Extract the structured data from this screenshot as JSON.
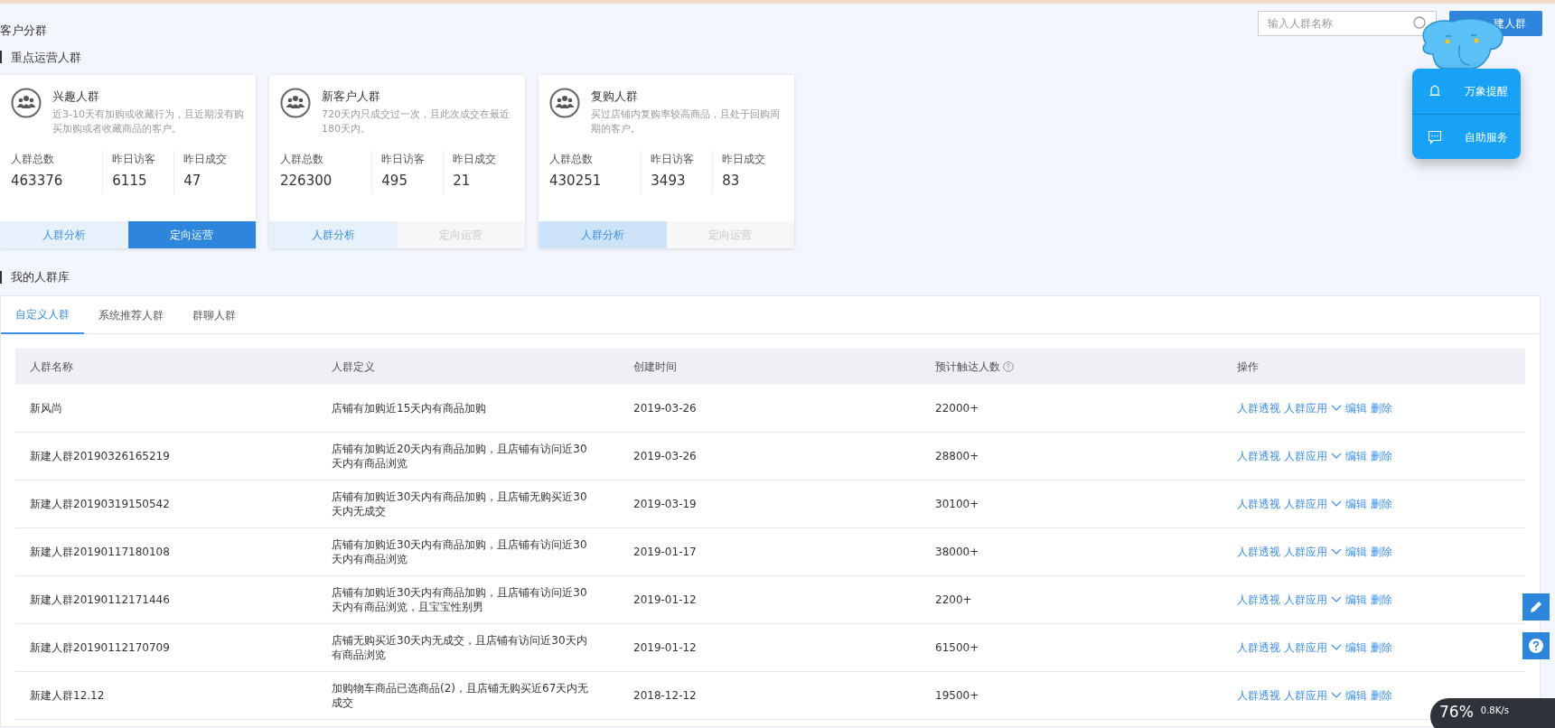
{
  "page_title": "客户分群",
  "search": {
    "placeholder": "输入人群名称"
  },
  "create_button": "建人群",
  "featured": {
    "title": "重点运营人群",
    "cards": [
      {
        "name": "兴趣人群",
        "desc": "近3-10天有加购或收藏行为，且近期没有购买加购或者收藏商品的客户。",
        "stats": [
          {
            "label": "人群总数",
            "value": "463376"
          },
          {
            "label": "昨日访客",
            "value": "6115"
          },
          {
            "label": "昨日成交",
            "value": "47"
          }
        ],
        "analysis": {
          "label": "人群分析",
          "highlighted": false
        },
        "operate": {
          "label": "定向运营",
          "disabled": false
        }
      },
      {
        "name": "新客户人群",
        "desc": "720天内只成交过一次，且此次成交在最近180天内。",
        "stats": [
          {
            "label": "人群总数",
            "value": "226300"
          },
          {
            "label": "昨日访客",
            "value": "495"
          },
          {
            "label": "昨日成交",
            "value": "21"
          }
        ],
        "analysis": {
          "label": "人群分析",
          "highlighted": false
        },
        "operate": {
          "label": "定向运营",
          "disabled": true
        }
      },
      {
        "name": "复购人群",
        "desc": "买过店铺内复购率较高商品，且处于回购周期的客户。",
        "stats": [
          {
            "label": "人群总数",
            "value": "430251"
          },
          {
            "label": "昨日访客",
            "value": "3493"
          },
          {
            "label": "昨日成交",
            "value": "83"
          }
        ],
        "analysis": {
          "label": "人群分析",
          "highlighted": true
        },
        "operate": {
          "label": "定向运营",
          "disabled": true
        }
      }
    ]
  },
  "library": {
    "title": "我的人群库",
    "tabs": [
      {
        "label": "自定义人群",
        "selected": true
      },
      {
        "label": "系统推荐人群",
        "selected": false
      },
      {
        "label": "群聊人群",
        "selected": false
      }
    ],
    "columns": [
      "人群名称",
      "人群定义",
      "创建时间",
      "预计触达人数",
      "操作"
    ],
    "rows": [
      {
        "name": "新风尚",
        "definition": "店铺有加购近15天内有商品加购",
        "created": "2019-03-26",
        "reach": "22000+",
        "actions": [
          "人群透视",
          "人群应用",
          "编辑",
          "删除"
        ]
      },
      {
        "name": "新建人群20190326165219",
        "definition": "店铺有加购近20天内有商品加购，且店铺有访问近30天内有商品浏览",
        "created": "2019-03-26",
        "reach": "28800+",
        "actions": [
          "人群透视",
          "人群应用",
          "编辑",
          "删除"
        ]
      },
      {
        "name": "新建人群20190319150542",
        "definition": "店铺有加购近30天内有商品加购，且店铺无购买近30天内无成交",
        "created": "2019-03-19",
        "reach": "30100+",
        "actions": [
          "人群透视",
          "人群应用",
          "编辑",
          "删除"
        ]
      },
      {
        "name": "新建人群20190117180108",
        "definition": "店铺有加购近30天内有商品加购，且店铺有访问近30天内有商品浏览",
        "created": "2019-01-17",
        "reach": "38000+",
        "actions": [
          "人群透视",
          "人群应用",
          "编辑",
          "删除"
        ]
      },
      {
        "name": "新建人群20190112171446",
        "definition": "店铺有加购近30天内有商品加购，且店铺有访问近30天内有商品浏览，且宝宝性别男",
        "created": "2019-01-12",
        "reach": "2200+",
        "actions": [
          "人群透视",
          "人群应用",
          "编辑",
          "删除"
        ]
      },
      {
        "name": "新建人群20190112170709",
        "definition": "店铺无购买近30天内无成交，且店铺有访问近30天内有商品浏览",
        "created": "2019-01-12",
        "reach": "61500+",
        "actions": [
          "人群透视",
          "人群应用",
          "编辑",
          "删除"
        ]
      },
      {
        "name": "新建人群12.12",
        "definition": "加购物车商品已选商品(2)，且店铺无购买近67天内无成交",
        "created": "2018-12-12",
        "reach": "19500+",
        "actions": [
          "人群透视",
          "人群应用",
          "编辑",
          "删除"
        ]
      }
    ]
  },
  "float_menu": [
    {
      "kind": "bell",
      "label": "万象提醒"
    },
    {
      "kind": "chat",
      "label": "自助服务"
    }
  ],
  "side_tools": [
    {
      "kind": "edit"
    },
    {
      "kind": "help"
    }
  ],
  "net_widget": {
    "percent": "76%",
    "upload": "0.8K/s"
  }
}
